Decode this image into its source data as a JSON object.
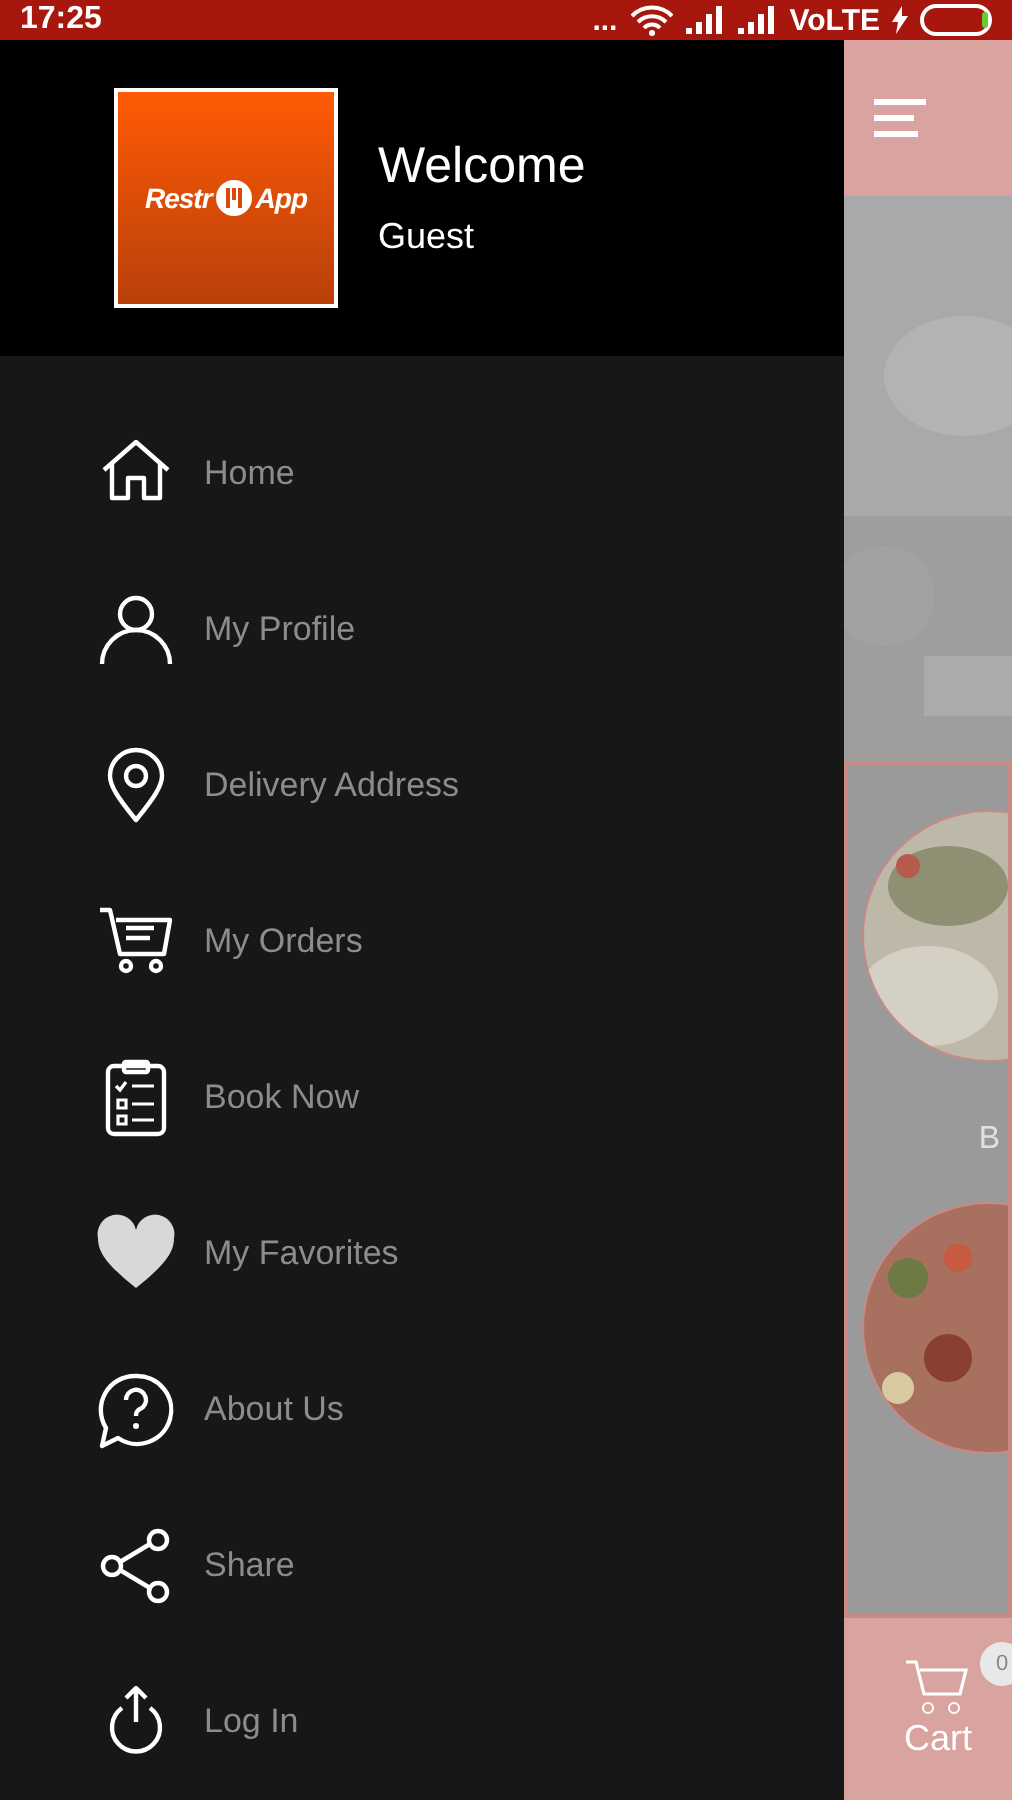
{
  "status_bar": {
    "time": "17:25",
    "more": "...",
    "network": "VoLTE"
  },
  "drawer": {
    "logo": {
      "left": "Restr",
      "right": "App"
    },
    "title": "Welcome",
    "subtitle": "Guest",
    "items": [
      {
        "kind": "home",
        "label": "Home"
      },
      {
        "kind": "profile",
        "label": "My Profile"
      },
      {
        "kind": "location",
        "label": "Delivery Address"
      },
      {
        "kind": "cart",
        "label": "My Orders"
      },
      {
        "kind": "clipboard",
        "label": "Book Now"
      },
      {
        "kind": "heart",
        "label": "My Favorites"
      },
      {
        "kind": "help",
        "label": "About Us"
      },
      {
        "kind": "share",
        "label": "Share"
      },
      {
        "kind": "power",
        "label": "Log In"
      }
    ]
  },
  "background": {
    "category_label": "B",
    "cart": {
      "label": "Cart",
      "count": "0"
    }
  }
}
